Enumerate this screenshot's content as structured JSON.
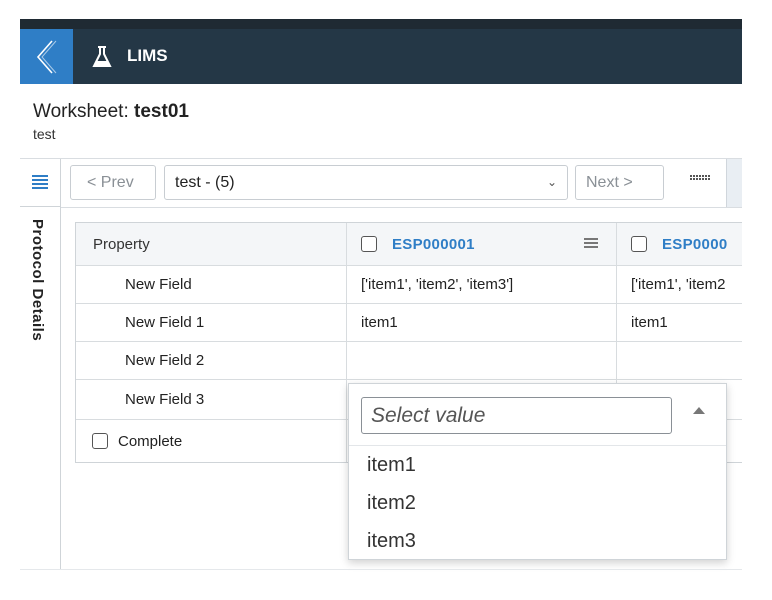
{
  "app": {
    "title": "LIMS"
  },
  "icons": {
    "back": "chevron-left-icon",
    "app": "flask-icon",
    "menu": "list-icon",
    "grid": "grid-icon",
    "column_menu": "hamburger-icon",
    "select_chevron": "chevron-down-icon",
    "dropdown_caret": "caret-up-icon"
  },
  "colors": {
    "appbar": "#243746",
    "back_button": "#2f7ec6",
    "accent": "#2f7ec6"
  },
  "worksheet": {
    "label": "Worksheet: ",
    "name": "test01",
    "subtitle": "test"
  },
  "sidebar": {
    "label": "Protocol Details"
  },
  "toolbar": {
    "prev_label": "< Prev",
    "next_label": "Next >",
    "select_value": "test - (5)"
  },
  "table": {
    "header": {
      "property": "Property",
      "col1": "ESP000001",
      "col2": "ESP0000"
    },
    "rows": [
      {
        "property": "New Field",
        "col1": "['item1', 'item2', 'item3']",
        "col2": "['item1', 'item2"
      },
      {
        "property": "New Field 1",
        "col1": "item1",
        "col2": "item1"
      },
      {
        "property": "New Field 2",
        "col1": "",
        "col2": ""
      },
      {
        "property": "New Field 3",
        "col1": "",
        "col2": ""
      }
    ],
    "complete_label": "Complete"
  },
  "dropdown": {
    "placeholder": "Select value",
    "options": [
      "item1",
      "item2",
      "item3"
    ]
  }
}
